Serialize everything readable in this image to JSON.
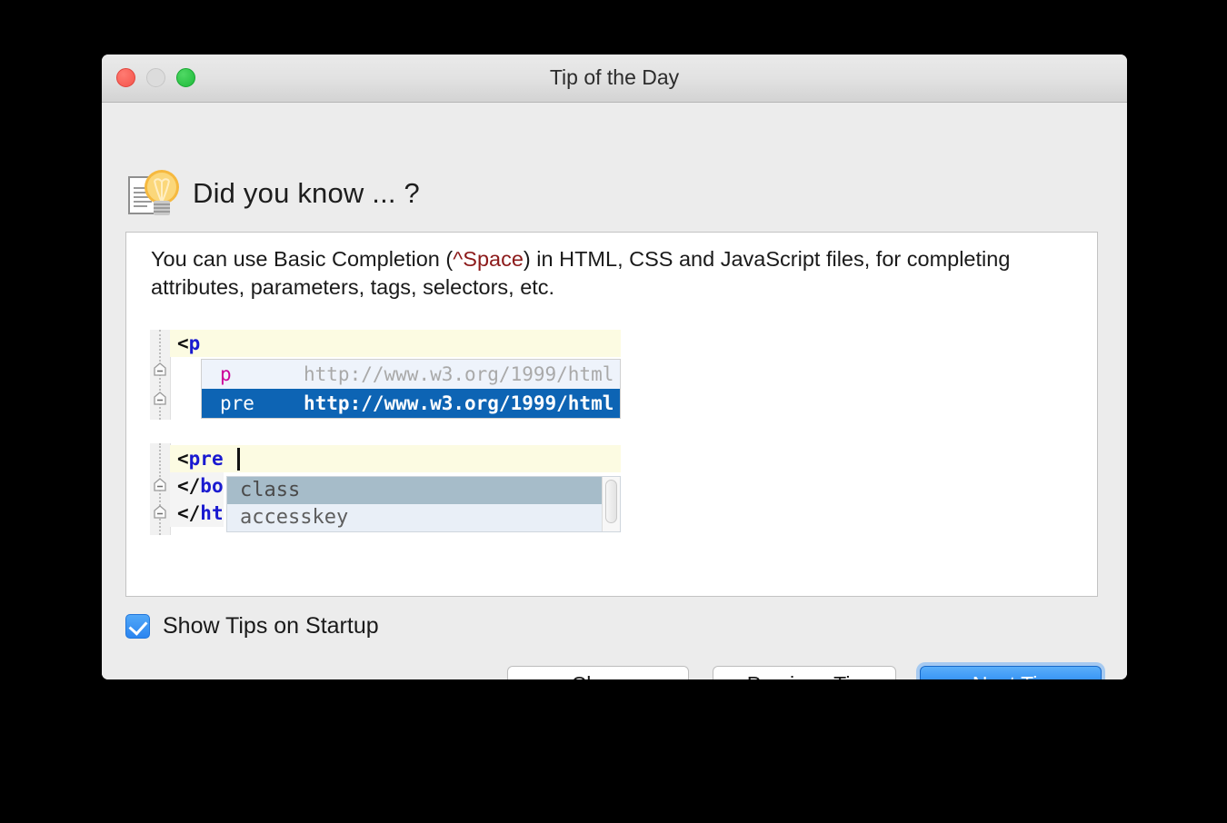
{
  "window": {
    "title": "Tip of the Day",
    "traffic_lights": [
      {
        "name": "close",
        "color": "#f4544b"
      },
      {
        "name": "minimize",
        "color": "#dcdcdc"
      },
      {
        "name": "maximize",
        "color": "#1fb93a"
      }
    ]
  },
  "header": {
    "icon": "lightbulb-document-icon",
    "title": "Did you know ... ?"
  },
  "tip": {
    "text_before_shortcut": "You can use Basic Completion (",
    "shortcut": "^Space",
    "text_after_shortcut": ") in HTML, CSS and JavaScript files, for completing attributes, parameters, tags, selectors, etc.",
    "shortcut_color": "#8c1a1a"
  },
  "code_shot_1": {
    "editor_line": {
      "bracket": "<",
      "tag": "p"
    },
    "completion_rows": [
      {
        "name": "p",
        "namespace": "http://www.w3.org/1999/html",
        "selected": false
      },
      {
        "name": "pre",
        "namespace": "http://www.w3.org/1999/html",
        "selected": true
      }
    ],
    "selected_color": "#0d64b4",
    "name_color": "#cc0099"
  },
  "code_shot_2": {
    "editor_lines": [
      {
        "bracket": "<",
        "tag": "pre",
        "highlighted": true
      },
      {
        "bracket": "</",
        "tag": "bo",
        "highlighted": false
      },
      {
        "bracket": "</",
        "tag": "ht",
        "highlighted": false
      }
    ],
    "completion_rows": [
      {
        "name": "class",
        "selected": true
      },
      {
        "name": "accesskey",
        "selected": false
      }
    ],
    "selected_color": "#a6bcc9"
  },
  "options": {
    "show_tips_label": "Show Tips on Startup",
    "show_tips_checked": true,
    "checkbox_color": "#2b85f0"
  },
  "buttons": {
    "close": "Close",
    "previous": "Previous Tip",
    "next": "Next Tip",
    "default_button_color": "#1178ef"
  }
}
